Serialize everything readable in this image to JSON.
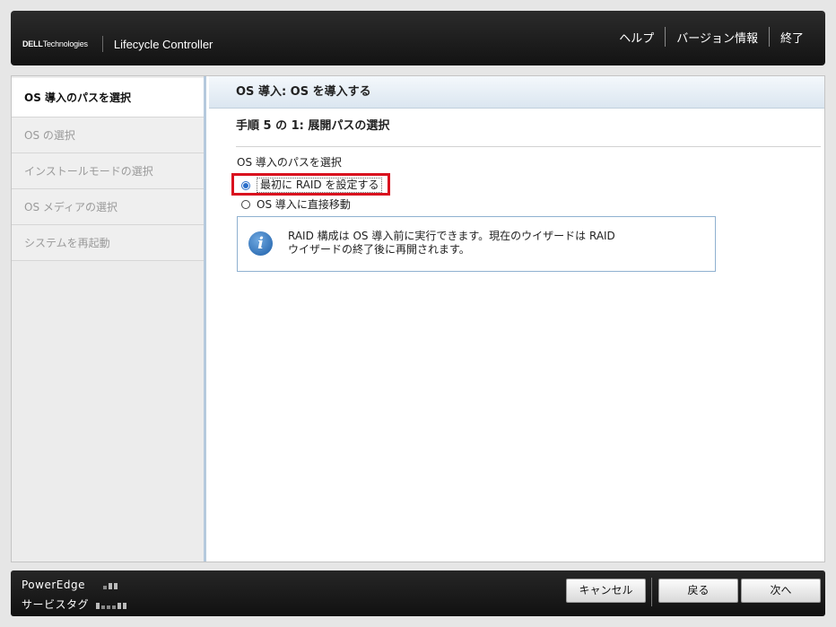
{
  "header": {
    "brand_dell": "DELL",
    "brand_technologies": "Technologies",
    "product": "Lifecycle Controller",
    "links": {
      "help": "ヘルプ",
      "version_info": "バージョン情報",
      "exit": "終了"
    }
  },
  "sidebar": {
    "steps": [
      {
        "label": "OS 導入のパスを選択",
        "state": "active"
      },
      {
        "label": "OS の選択",
        "state": "disabled"
      },
      {
        "label": "インストールモードの選択",
        "state": "disabled"
      },
      {
        "label": "OS メディアの選択",
        "state": "disabled"
      },
      {
        "label": "システムを再起動",
        "state": "disabled"
      }
    ]
  },
  "main": {
    "title": "OS 導入: OS を導入する",
    "step_heading": "手順 5 の 1: 展開パスの選択",
    "group_label": "OS 導入のパスを選択",
    "options": [
      {
        "label": "最初に RAID を設定する",
        "selected": true
      },
      {
        "label": "OS 導入に直接移動",
        "selected": false
      }
    ],
    "info": {
      "icon": "info-icon",
      "line1": "RAID 構成は OS 導入前に実行できます。現在のウイザードは RAID",
      "line2": "ウイザードの終了後に再開されます。"
    }
  },
  "footer": {
    "model": "PowerEdge",
    "service_tag_label": "サービスタグ",
    "buttons": {
      "cancel": "キャンセル",
      "back": "戻る",
      "next": "次へ"
    }
  },
  "colors": {
    "highlight": "#d9101e",
    "accent": "#2a6fc9",
    "header_bg": "#1c1c1c"
  }
}
